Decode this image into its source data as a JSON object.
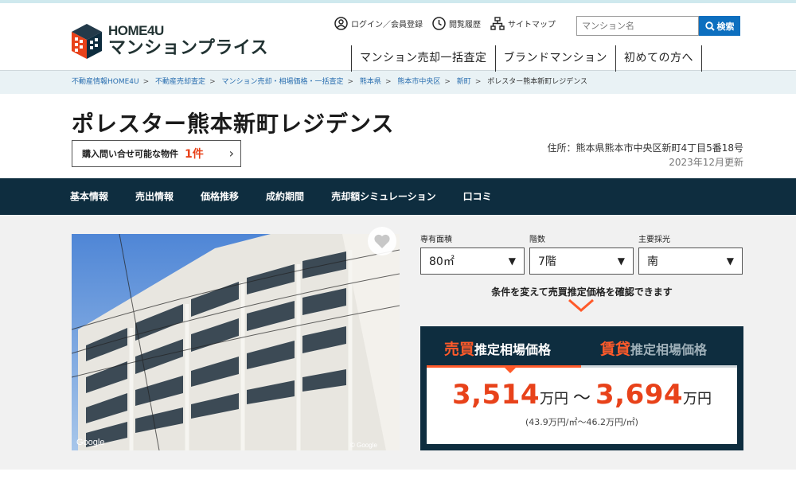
{
  "logo": {
    "line1": "HOME4U",
    "line2": "マンションプライス"
  },
  "util": {
    "login": "ログイン／会員登録",
    "history": "閲覧履歴",
    "sitemap": "サイトマップ"
  },
  "search": {
    "placeholder": "マンション名",
    "button": "検索"
  },
  "gnav": [
    "マンション売却一括査定",
    "ブランドマンション",
    "初めての方へ"
  ],
  "breadcrumb": [
    "不動産情報HOME4U",
    "不動産売却査定",
    "マンション売却・相場価格・一括査定",
    "熊本県",
    "熊本市中央区",
    "新町",
    "ポレスター熊本新町レジデンス"
  ],
  "property": {
    "title": "ポレスター熊本新町レジデンス",
    "inquiry_label": "購入問い合せ可能な物件",
    "inquiry_count": "1件",
    "address": "住所：熊本県熊本市中央区新町4丁目5番18号",
    "updated": "2023年12月更新"
  },
  "tabs": [
    "基本情報",
    "売出情報",
    "価格推移",
    "成約期間",
    "売却額シミュレーション",
    "口コミ"
  ],
  "photo": {
    "watermark": "Google",
    "watermark2": "© Google"
  },
  "selects": [
    {
      "label": "専有面積",
      "value": "80㎡"
    },
    {
      "label": "階数",
      "value": "7階"
    },
    {
      "label": "主要採光",
      "value": "南"
    }
  ],
  "hint": "条件を変えて売買推定価格を確認できます",
  "price": {
    "sale_big": "売買",
    "sale_small": "推定相場価格",
    "rent_big": "賃貸",
    "rent_small": "推定相場価格",
    "low": "3,514",
    "high": "3,694",
    "unit": "万円",
    "tilde": "～",
    "per_sqm": "(43.9万円/㎡～46.2万円/㎡)"
  },
  "colors": {
    "navy": "#0e2d3f",
    "accent": "#ff5a2a",
    "link": "#2a6fb0",
    "search_btn": "#0d6fbf"
  }
}
